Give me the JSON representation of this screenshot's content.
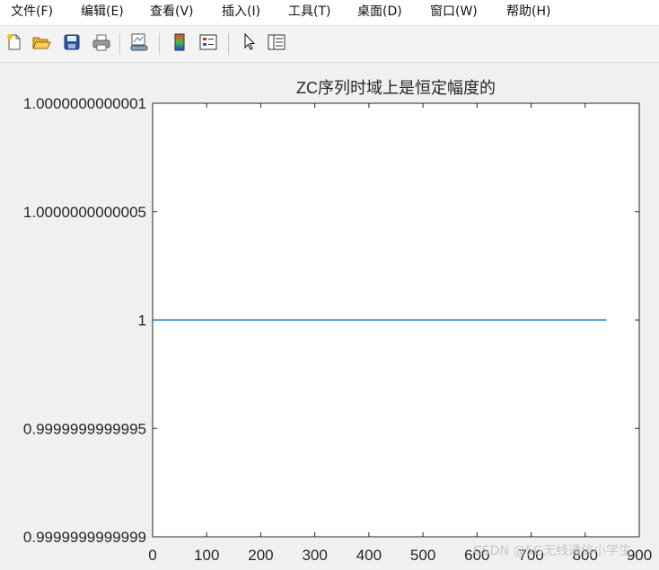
{
  "menu": {
    "file": "文件(F)",
    "edit": "编辑(E)",
    "view": "查看(V)",
    "insert": "插入(I)",
    "tools": "工具(T)",
    "desktop": "桌面(D)",
    "window": "窗口(W)",
    "help": "帮助(H)"
  },
  "toolbar": {
    "icons": [
      "new-figure-icon",
      "open-file-icon",
      "save-icon",
      "print-icon",
      "link-plot-icon",
      "colorbar-icon",
      "legend-icon",
      "pointer-icon",
      "property-inspector-icon"
    ]
  },
  "watermark": "CSDN @5G无线通信小学生",
  "chart_data": {
    "type": "line",
    "title": "ZC序列时域上是恒定幅度的",
    "xlabel": "",
    "ylabel": "",
    "xlim": [
      0,
      900
    ],
    "ylim": [
      0.9999999999999,
      1.0000000000001
    ],
    "xticks": [
      "0",
      "100",
      "200",
      "300",
      "400",
      "500",
      "600",
      "700",
      "800",
      "900"
    ],
    "yticks": [
      "0.9999999999999",
      "0.9999999999995",
      "1",
      "1.0000000000005",
      "1.0000000000001"
    ],
    "ytick_offsets_e13": [
      -1,
      -0.5,
      0,
      0.5,
      1
    ],
    "series_color": "#0072bd",
    "series": [
      {
        "x": [
          1,
          839
        ],
        "y": [
          1,
          1
        ]
      }
    ],
    "grid": false
  }
}
